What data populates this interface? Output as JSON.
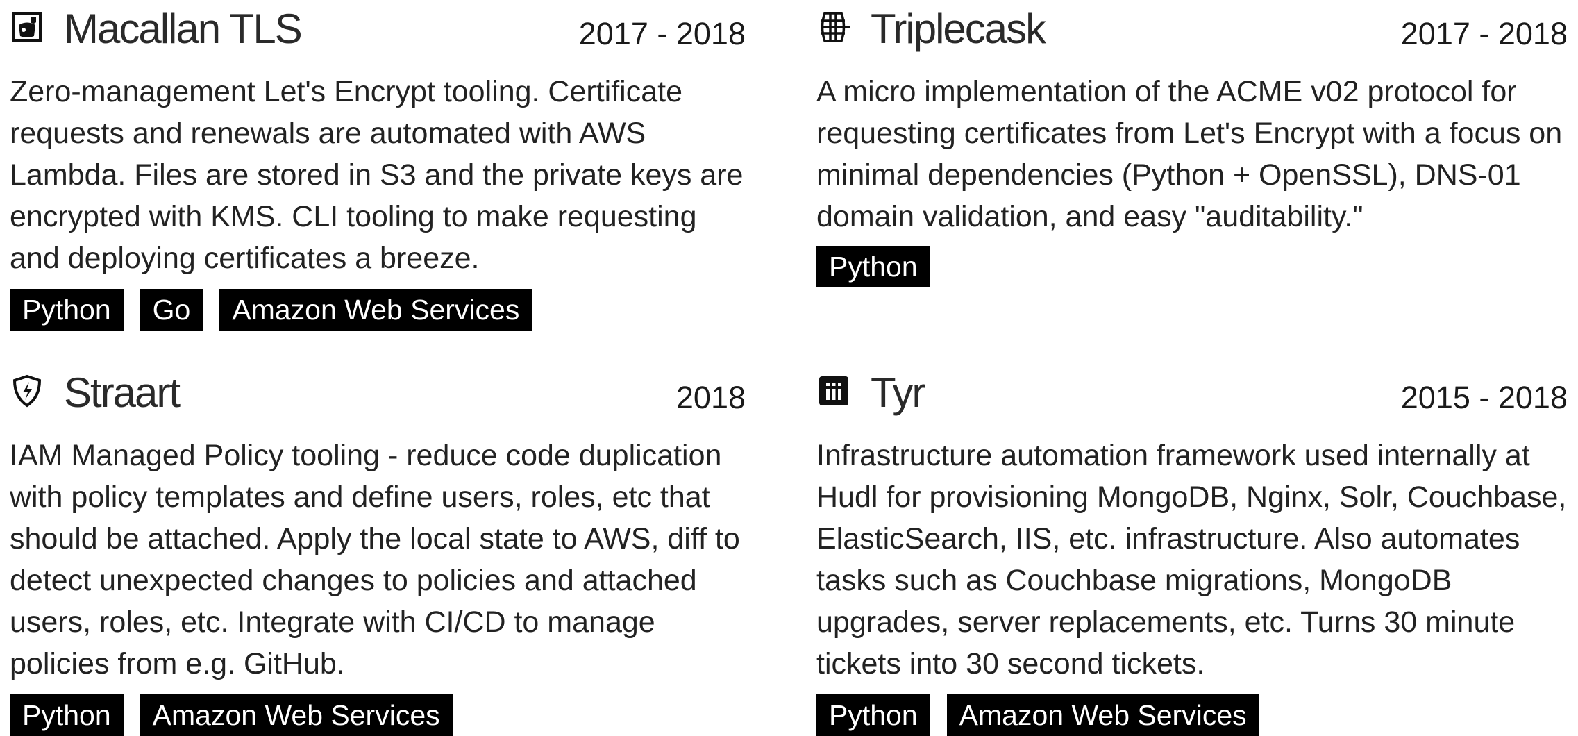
{
  "projects": [
    {
      "icon": "whisky-glass-icon",
      "title": "Macallan TLS",
      "years": "2017 - 2018",
      "description": "Zero-management Let's Encrypt tooling. Certificate requests and renewals are automated with AWS Lambda. Files are stored in S3 and the private keys are encrypted with KMS. CLI tooling to make requesting and deploying certificates a breeze.",
      "tags": [
        "Python",
        "Go",
        "Amazon Web Services"
      ]
    },
    {
      "icon": "barrel-icon",
      "title": "Triplecask",
      "years": "2017 - 2018",
      "description": "A micro implementation of the ACME v02 protocol for requesting certificates from Let's Encrypt with a focus on minimal dependencies (Python + OpenSSL), DNS-01 domain validation, and easy \"auditability.\"",
      "tags": [
        "Python"
      ]
    },
    {
      "icon": "shield-bolt-icon",
      "title": "Straart",
      "years": "2018",
      "description": "IAM Managed Policy tooling - reduce code duplication with policy templates and define users, roles, etc that should be attached. Apply the local state to AWS, diff to detect unexpected changes to policies and attached users, roles, etc.  Integrate with CI/CD to manage policies from e.g. GitHub.",
      "tags": [
        "Python",
        "Amazon Web Services"
      ]
    },
    {
      "icon": "building-icon",
      "title": "Tyr",
      "years": "2015 - 2018",
      "description": "Infrastructure automation framework used internally at Hudl for provisioning MongoDB, Nginx, Solr, Couchbase, ElasticSearch, IIS, etc. infrastructure. Also automates tasks such as Couchbase migrations, MongoDB upgrades, server replacements, etc. Turns 30 minute tickets into 30 second tickets.",
      "tags": [
        "Python",
        "Amazon Web Services"
      ]
    }
  ]
}
